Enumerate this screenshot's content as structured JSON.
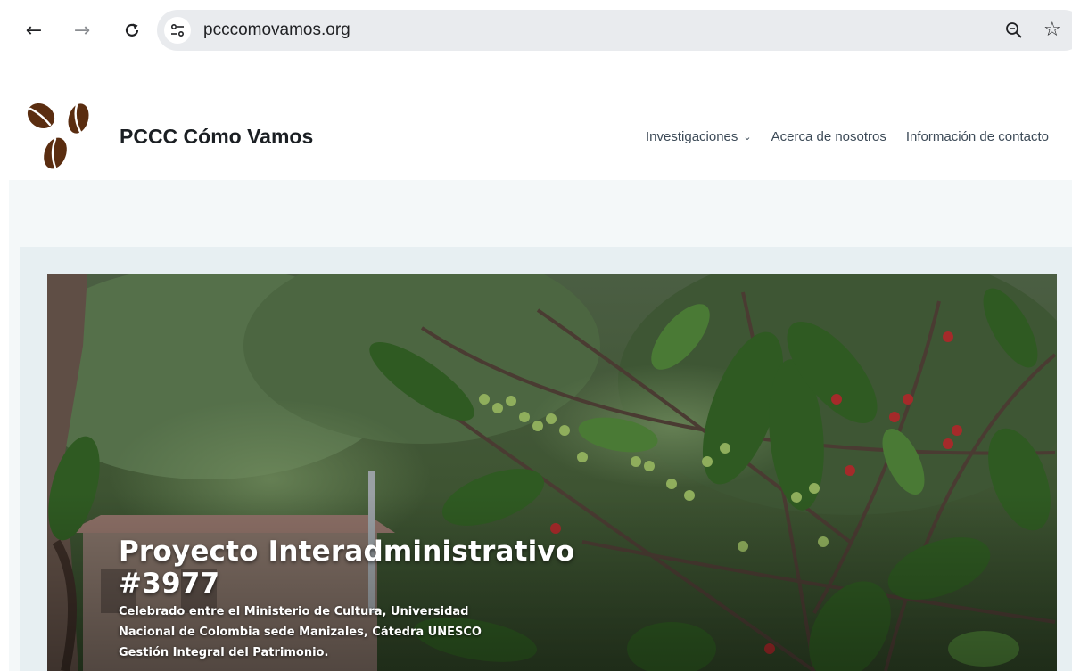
{
  "browser": {
    "url": "pcccomovamos.org",
    "icons": {
      "back": "arrow-left-icon",
      "forward": "arrow-right-icon",
      "reload": "reload-icon",
      "site_info": "tune-icon",
      "zoom": "zoom-icon",
      "bookmark": "star-icon"
    }
  },
  "site": {
    "title": "PCCC Cómo Vamos",
    "logo": "coffee-beans-logo",
    "nav": [
      {
        "label": "Investigaciones",
        "has_dropdown": true
      },
      {
        "label": "Acerca de nosotros",
        "has_dropdown": false
      },
      {
        "label": "Información de contacto",
        "has_dropdown": false
      }
    ]
  },
  "hero": {
    "title": "Proyecto Interadministrativo #3977",
    "subtitle": "Celebrado entre el Ministerio de Cultura, Universidad Nacional de Colombia sede Manizales, Cátedra UNESCO Gestión Integral del Patrimonio.",
    "image": "coffee-plant-photo"
  },
  "colors": {
    "bean_brown": "#5a2d10",
    "page_background": "#f4f8f9",
    "card_background": "#e7eff2"
  }
}
